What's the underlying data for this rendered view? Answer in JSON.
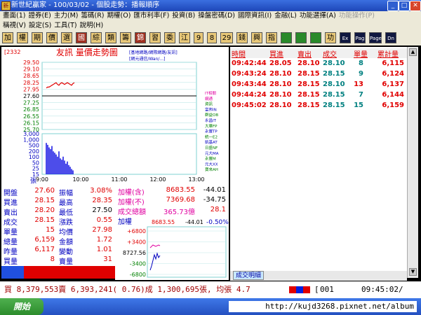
{
  "window": {
    "title": "新世紀贏家 - 100/03/02 - 個股走勢：播報順序",
    "min": "_",
    "max": "□",
    "close": "✕"
  },
  "menu1": [
    "畫面(1)",
    "證券(E)",
    "主力(M)",
    "籌碼(R)",
    "期權(O)",
    "匯市利率(F)",
    "投資(B)",
    "操盤密碼(D)",
    "國際資訊(I)",
    "金融(L)",
    "功能選擇(A)",
    "功能操作(P)"
  ],
  "menu2": [
    "稱視(V)",
    "設定(S)",
    "工具(T)",
    "說明(H)"
  ],
  "toolbar": [
    "加",
    "權",
    "期",
    "價",
    "選",
    "國",
    "綜",
    "類",
    "籌",
    "錦",
    "習",
    "委",
    "江",
    "9",
    "8",
    "29",
    "錢",
    "興",
    "指",
    "",
    "",
    "",
    "功",
    "Ex",
    "Pag",
    "Page",
    "Dn"
  ],
  "chart": {
    "stock_code": "2332",
    "title": "友訊 量價走勢圖",
    "y_labels": [
      "29.50",
      "29.10",
      "28.65",
      "28.25",
      "27.95",
      "27.60",
      "27.25",
      "26.85",
      "26.55",
      "26.15",
      "25.70"
    ],
    "vol_labels": [
      "3,000",
      "1,000",
      "500",
      "200",
      "100",
      "50",
      "25",
      "15"
    ],
    "vol_unit": "張",
    "x_labels": [
      "9:00",
      "10:00",
      "11:00",
      "12:00",
      "13:00"
    ],
    "notes": [
      "[基地網路/網際網路/友訊]",
      "[網元通信/Wan/...]"
    ],
    "legend_items": [
      "IT相關",
      "網通",
      "資訊",
      "富邦IN",
      "群益OB",
      "永昌IT",
      "大華FP",
      "永豐TP",
      "統一E2",
      "凱基AT",
      "日盛NF",
      "元大MA",
      "永豐M",
      "元大XX",
      "寶來AH"
    ],
    "price_series": [
      28.05,
      28.1,
      28.1,
      28.15,
      28.2,
      28.25,
      28.3,
      28.35,
      28.25,
      28.2,
      28.3,
      28.35,
      28.3,
      28.25,
      28.3,
      28.35,
      28.3,
      28.25,
      28.2,
      28.3,
      28.35
    ],
    "volume_series": [
      900,
      700,
      500,
      400,
      600,
      300,
      250,
      200,
      150,
      300,
      120,
      100,
      150,
      90,
      60,
      80,
      50,
      40,
      30,
      25
    ],
    "reference_price": 27.6,
    "y_min": 25.7,
    "y_max": 29.5
  },
  "info": {
    "rows": [
      {
        "l1": "開盤",
        "v1": "27.60",
        "l2": "振幅",
        "v2": "3.08%"
      },
      {
        "l1": "買進",
        "v1": "28.15",
        "l2": "最高",
        "v2": "28.35"
      },
      {
        "l1": "賣出",
        "v1": "28.20",
        "l2": "最低",
        "v2": "27.50"
      },
      {
        "l1": "成交",
        "v1": "28.15",
        "l2": "漲跌",
        "v2": "0.55"
      },
      {
        "l1": "單量",
        "v1": "15",
        "l2": "均價",
        "v2": "27.98"
      },
      {
        "l1": "總量",
        "v1": "6,159",
        "l2": "金額",
        "v2": "1.72"
      },
      {
        "l1": "昨量",
        "v1": "6,117",
        "l2": "變動",
        "v2": "1.01"
      },
      {
        "l1": "買量",
        "v1": "8",
        "l2": "賣量",
        "v2": "31"
      }
    ],
    "bar_split": 0.2
  },
  "index": {
    "rows": [
      {
        "label": "加權(含)",
        "value": "8683.55",
        "change": "-44.01"
      },
      {
        "label": "加權(不)",
        "value": "7369.68",
        "change": "-34.75"
      },
      {
        "label": "成交總額",
        "value": "365.73億",
        "change": "28.1"
      }
    ]
  },
  "mini": {
    "label": "加權",
    "value": "8683.55",
    "change": "-44.01",
    "pct": "-0.50%",
    "y_labels": [
      "+6800",
      "+3400",
      "8727.56",
      "-3400",
      "-6800"
    ]
  },
  "ticks": {
    "headers": [
      "時間",
      "買進",
      "賣出",
      "成交",
      "單量",
      "累計量"
    ],
    "rows": [
      {
        "time": "09:42:44",
        "bid": "28.05",
        "ask": "28.10",
        "deal": "28.10",
        "vol": "8",
        "total": "6,115"
      },
      {
        "time": "09:43:24",
        "bid": "28.10",
        "ask": "28.15",
        "deal": "28.15",
        "vol": "9",
        "total": "6,124"
      },
      {
        "time": "09:43:44",
        "bid": "28.10",
        "ask": "28.15",
        "deal": "28.10",
        "vol": "13",
        "total": "6,137"
      },
      {
        "time": "09:44:24",
        "bid": "28.10",
        "ask": "28.15",
        "deal": "28.15",
        "vol": "7",
        "total": "6,144"
      },
      {
        "time": "09:45:02",
        "bid": "28.10",
        "ask": "28.15",
        "deal": "28.15",
        "vol": "15",
        "total": "6,159"
      }
    ],
    "tab": "成交明細"
  },
  "status": {
    "text": "買 8,379,553賣 6,393,241( 0.76)成 1,300,695張, 均張 4.7",
    "code": "001",
    "clock": "09:45:02/"
  },
  "taskbar": {
    "start": "開始",
    "watermark": "http://kujd3268.pixnet.net/album"
  }
}
